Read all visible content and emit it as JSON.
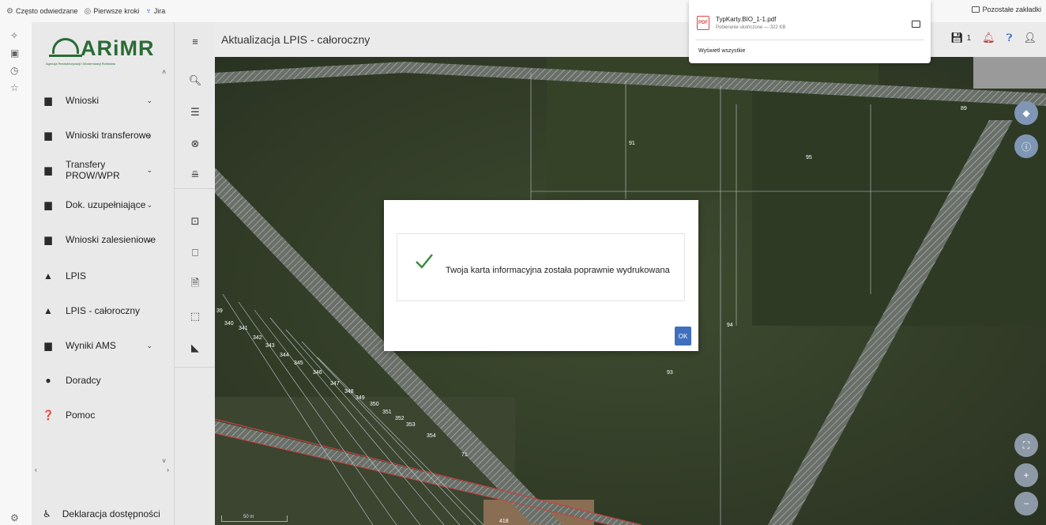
{
  "bookmarks": {
    "items": [
      "Często odwiedzane",
      "Pierwsze kroki",
      "Jira"
    ],
    "other": "Pozostałe zakładki"
  },
  "logo": {
    "name": "ARiMR",
    "subtitle": "Agencja Restrukturyzacji i Modernizacji Rolnictwa"
  },
  "sidebar": {
    "items": [
      {
        "label": "Wnioski",
        "icon": "clipboard-icon",
        "has_chevron": true
      },
      {
        "label": "Wnioski transferowe",
        "icon": "clipboard-icon",
        "has_chevron": true
      },
      {
        "label": "Transfery PROW/WPR",
        "icon": "clipboard-icon",
        "has_chevron": true
      },
      {
        "label": "Dok. uzupełniające",
        "icon": "clipboard-icon",
        "has_chevron": true
      },
      {
        "label": "Wnioski zalesieniowe",
        "icon": "clipboard-icon",
        "has_chevron": true
      },
      {
        "label": "LPIS",
        "icon": "mountain-icon",
        "has_chevron": false
      },
      {
        "label": "LPIS - całoroczny",
        "icon": "mountain-icon",
        "has_chevron": false
      },
      {
        "label": "Wyniki AMS",
        "icon": "clipboard-icon",
        "has_chevron": true
      },
      {
        "label": "Doradcy",
        "icon": "person-icon",
        "has_chevron": false
      },
      {
        "label": "Pomoc",
        "icon": "help-icon",
        "has_chevron": false
      }
    ],
    "footer_label": "Deklaracja dostępności"
  },
  "header": {
    "title": "Aktualizacja LPIS - całoroczny",
    "notification_count": "1"
  },
  "map": {
    "plot_labels": [
      "89",
      "91",
      "95",
      "94",
      "93",
      "71",
      "418",
      "39",
      "340",
      "341",
      "342",
      "343",
      "344",
      "345",
      "346",
      "347",
      "348",
      "349",
      "350",
      "351",
      "352",
      "353",
      "354"
    ],
    "scale_label": "50 m",
    "colors": {
      "parcel_line": "#c0c8d0",
      "boundary": "#c84040"
    }
  },
  "modal": {
    "message": "Twoja karta informacyjna została poprawnie wydrukowana",
    "ok_label": "OK"
  },
  "download": {
    "filename": "TypKarty.BIO_1-1.pdf",
    "status": "Pobieranie ukończone — 322 KB",
    "show_all": "Wyświetl wszystkie"
  }
}
